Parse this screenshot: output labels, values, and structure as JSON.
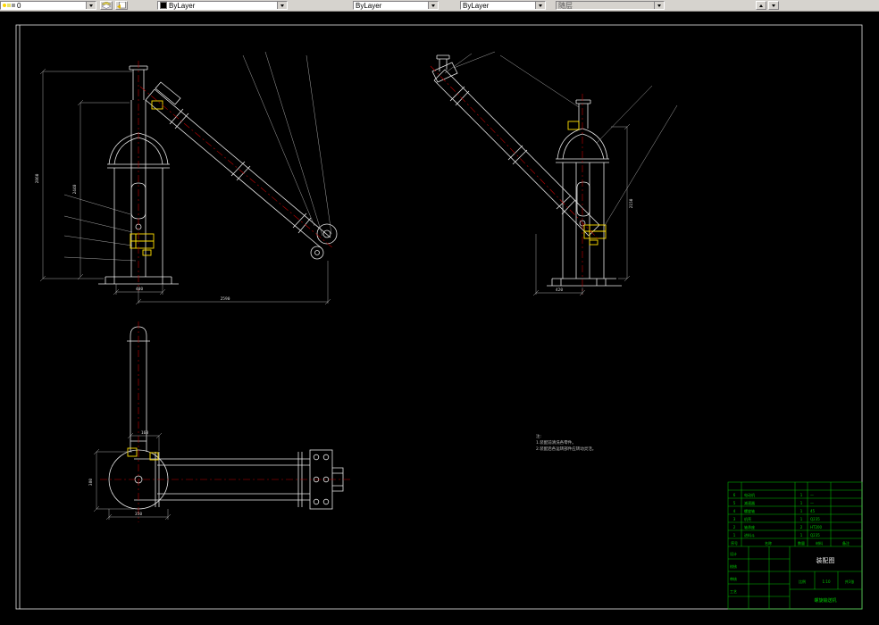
{
  "toolbar": {
    "layer_combo": {
      "value": "0"
    },
    "color_combo": {
      "value": "ByLayer"
    },
    "linetype_combo": {
      "value": "ByLayer"
    },
    "lineweight_combo": {
      "value": "ByLayer"
    },
    "plotstyle_combo": {
      "value": "随层"
    }
  },
  "drawing": {
    "dims": {
      "front_height": "2860",
      "front_mid_height": "2440",
      "front_span": "2590",
      "front_base": "400",
      "side_height": "2150",
      "side_base": "420",
      "plan_height": "380",
      "plan_flange": "160",
      "plan_base": "350"
    },
    "notes": {
      "title": "注:",
      "line1": "1.装配前清洗各零件。",
      "line2": "2.装配后各运转部件应转动灵活。"
    },
    "title_block": {
      "title": "装配图",
      "product": "螺旋输送机",
      "labels": {
        "design": "设计",
        "check": "校核",
        "approve": "审核",
        "process": "工艺",
        "scale": "比例",
        "scale_value": "1:10",
        "sheet": "共1张"
      },
      "list_headers": {
        "no": "序号",
        "name": "名称",
        "qty": "数量",
        "material": "材料",
        "remark": "备注"
      },
      "parts": [
        [
          "6",
          "电动机",
          "1",
          "—"
        ],
        [
          "5",
          "减速器",
          "1",
          "—"
        ],
        [
          "4",
          "螺旋轴",
          "1",
          "45"
        ],
        [
          "3",
          "机壳",
          "1",
          "Q235"
        ],
        [
          "2",
          "轴承座",
          "2",
          "HT200"
        ],
        [
          "1",
          "进料斗",
          "1",
          "Q235"
        ]
      ]
    }
  }
}
